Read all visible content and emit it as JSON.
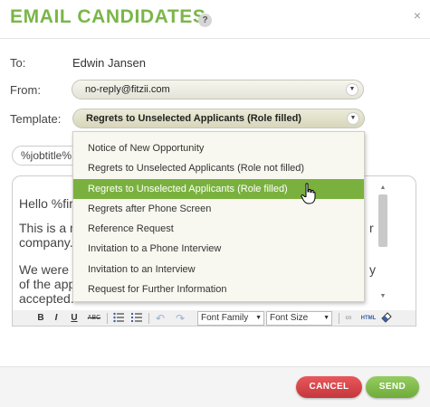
{
  "dialog": {
    "title": "EMAIL CANDIDATES",
    "help_glyph": "?",
    "close_glyph": "×"
  },
  "form": {
    "to_label": "To:",
    "to_value": "Edwin Jansen",
    "from_label": "From:",
    "from_value": "no-reply@fitzii.com",
    "template_label": "Template:",
    "template_value": "Regrets to Unselected Applicants (Role filled)",
    "subject_value": "%jobtitle%"
  },
  "template_options": [
    "Notice of New Opportunity",
    "Regrets to Unselected Applicants (Role not filled)",
    "Regrets to Unselected Applicants (Role filled)",
    "Regrets after Phone Screen",
    "Reference Request",
    "Invitation to a Phone Interview",
    "Invitation to an Interview",
    "Request for Further Information"
  ],
  "template_selected_index": 2,
  "editor": {
    "lines": [
      "Hello %fir",
      "This is a n",
      "company.",
      "We were e",
      "of the app",
      "accepted."
    ],
    "right_fragments": [
      "r",
      "y"
    ]
  },
  "toolbar": {
    "bold": "B",
    "italic": "I",
    "underline": "U",
    "strike": "ABC",
    "font_family": "Font Family",
    "font_size": "Font Size",
    "html": "HTML"
  },
  "buttons": {
    "cancel": "CANCEL",
    "send": "SEND"
  },
  "colors": {
    "accent_green": "#7ab648",
    "selected_green": "#7ab13e",
    "cancel_red": "#d9474c",
    "send_green": "#85be4f"
  },
  "icons": [
    "help-icon",
    "close-icon",
    "dropdown-caret-icon",
    "bullet-list-icon",
    "numbered-list-icon",
    "undo-icon",
    "redo-icon",
    "link-icon",
    "eraser-icon",
    "hand-cursor-icon"
  ]
}
